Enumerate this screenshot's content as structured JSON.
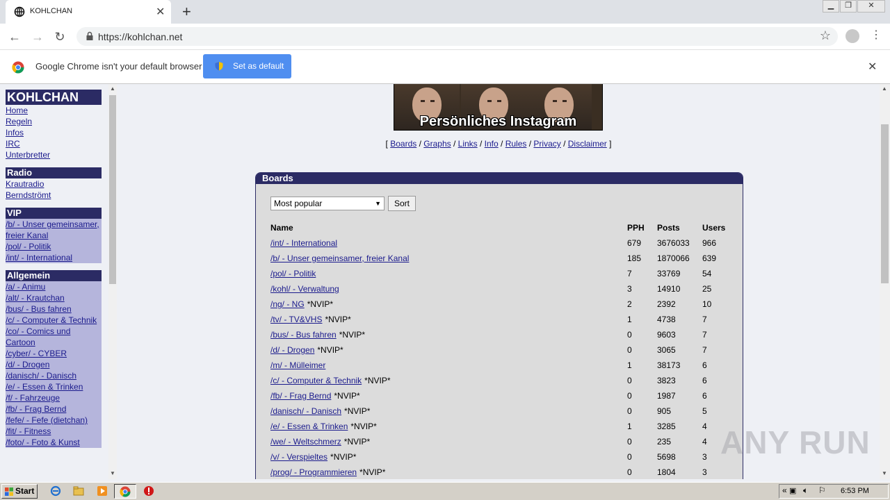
{
  "browser": {
    "tab_title": "KOHLCHAN",
    "url": "https://kohlchan.net",
    "infobar_message": "Google Chrome isn't your default browser",
    "set_default_label": "Set as default"
  },
  "sidebar": {
    "groups": [
      {
        "title": "KOHLCHAN",
        "links": [
          "Home",
          "Regeln",
          "Infos",
          "IRC",
          "Unterbretter"
        ]
      },
      {
        "title": "Radio",
        "links": [
          "Krautradio",
          "Berndströmt"
        ]
      },
      {
        "title": "VIP",
        "links": [
          "/b/ - Unser gemeinsamer, freier Kanal",
          "/pol/ - Politik",
          "/int/ - International"
        ]
      },
      {
        "title": "Allgemein",
        "links": [
          "/a/ - Animu",
          "/alt/ - Krautchan",
          "/bus/ - Bus fahren",
          "/c/ - Computer & Technik",
          "/co/ - Comics und Cartoon",
          "/cyber/ - CYBER",
          "/d/ - Drogen",
          "/danisch/ - Danisch",
          "/e/ - Essen & Trinken",
          "/f/ - Fahrzeuge",
          "/fb/ - Frag Bernd",
          "/fefe/ - Fefe (dietchan)",
          "/fit/ - Fitness",
          "/foto/ - Foto & Kunst"
        ]
      }
    ]
  },
  "banner": {
    "caption": "Persönliches Instagram"
  },
  "nav_links": [
    "Boards",
    "Graphs",
    "Links",
    "Info",
    "Rules",
    "Privacy",
    "Disclaimer"
  ],
  "boards": {
    "title": "Boards",
    "sort_selected": "Most popular",
    "sort_button": "Sort",
    "columns": [
      "Name",
      "PPH",
      "Posts",
      "Users"
    ],
    "rows": [
      {
        "name": "/int/ - International",
        "tag": "",
        "pph": "679",
        "posts": "3676033",
        "users": "966"
      },
      {
        "name": "/b/ - Unser gemeinsamer, freier Kanal",
        "tag": "",
        "pph": "185",
        "posts": "1870066",
        "users": "639"
      },
      {
        "name": "/pol/ - Politik",
        "tag": "",
        "pph": "7",
        "posts": "33769",
        "users": "54"
      },
      {
        "name": "/kohl/ - Verwaltung",
        "tag": "",
        "pph": "3",
        "posts": "14910",
        "users": "25"
      },
      {
        "name": "/ng/ - NG",
        "tag": "*NVIP*",
        "pph": "2",
        "posts": "2392",
        "users": "10"
      },
      {
        "name": "/tv/ - TV&VHS",
        "tag": "*NVIP*",
        "pph": "1",
        "posts": "4738",
        "users": "7"
      },
      {
        "name": "/bus/ - Bus fahren",
        "tag": "*NVIP*",
        "pph": "0",
        "posts": "9603",
        "users": "7"
      },
      {
        "name": "/d/ - Drogen",
        "tag": "*NVIP*",
        "pph": "0",
        "posts": "3065",
        "users": "7"
      },
      {
        "name": "/m/ - Mülleimer",
        "tag": "",
        "pph": "1",
        "posts": "38173",
        "users": "6"
      },
      {
        "name": "/c/ - Computer & Technik",
        "tag": "*NVIP*",
        "pph": "0",
        "posts": "3823",
        "users": "6"
      },
      {
        "name": "/fb/ - Frag Bernd",
        "tag": "*NVIP*",
        "pph": "0",
        "posts": "1987",
        "users": "6"
      },
      {
        "name": "/danisch/ - Danisch",
        "tag": "*NVIP*",
        "pph": "0",
        "posts": "905",
        "users": "5"
      },
      {
        "name": "/e/ - Essen & Trinken",
        "tag": "*NVIP*",
        "pph": "1",
        "posts": "3285",
        "users": "4"
      },
      {
        "name": "/we/ - Weltschmerz",
        "tag": "*NVIP*",
        "pph": "0",
        "posts": "235",
        "users": "4"
      },
      {
        "name": "/v/ - Verspieltes",
        "tag": "*NVIP*",
        "pph": "0",
        "posts": "5698",
        "users": "3"
      },
      {
        "name": "/prog/ - Programmieren",
        "tag": "*NVIP*",
        "pph": "0",
        "posts": "1804",
        "users": "3"
      }
    ]
  },
  "watermark": "ANY RUN",
  "taskbar": {
    "start_label": "Start",
    "clock": "6:53 PM"
  }
}
